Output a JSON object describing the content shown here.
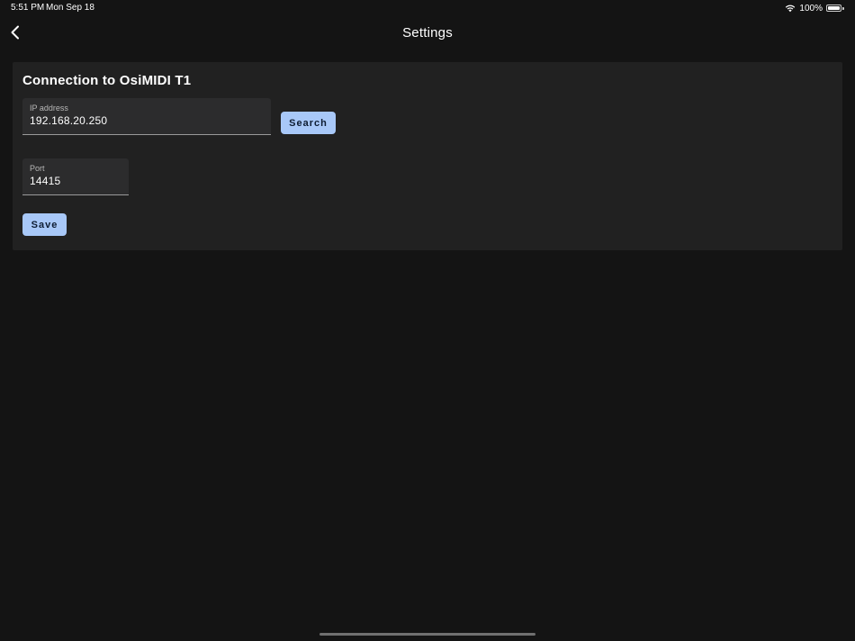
{
  "status_bar": {
    "time": "5:51 PM",
    "date": "Mon Sep 18",
    "battery": "100%",
    "wifi_icon": "wifi-icon",
    "battery_icon": "battery-full-icon"
  },
  "nav": {
    "title": "Settings",
    "back_icon": "chevron-left-icon"
  },
  "connection": {
    "title": "Connection to OsiMIDI T1",
    "ip": {
      "label": "IP address",
      "value": "192.168.20.250"
    },
    "search_label": "Search",
    "port": {
      "label": "Port",
      "value": "14415"
    },
    "save_label": "Save"
  },
  "colors": {
    "background": "#141414",
    "card": "#212121",
    "field": "#2c2c2d",
    "accent_button": "#a8c8f8",
    "button_text": "#0e1d33"
  }
}
